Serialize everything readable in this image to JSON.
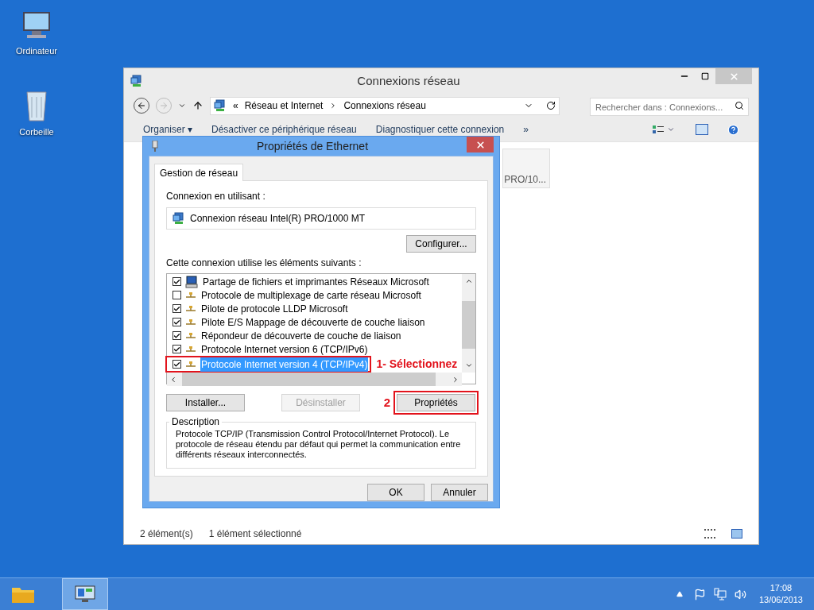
{
  "desktop_icons": [
    {
      "label": "Ordinateur",
      "kind": "computer"
    },
    {
      "label": "Corbeille",
      "kind": "bin"
    }
  ],
  "explorer": {
    "title": "Connexions réseau",
    "breadcrumb": [
      "«",
      "Réseau et Internet",
      "Connexions réseau"
    ],
    "search": {
      "placeholder": "Rechercher dans : Connexions..."
    },
    "toolbar": [
      "Organiser ▾",
      "Désactiver ce périphérique réseau",
      "Diagnostiquer cette connexion",
      "»"
    ],
    "tile_text": "PRO/10...",
    "status_bar": [
      "2 élément(s)",
      "1 élément sélectionné"
    ]
  },
  "dialog": {
    "title": "Propriétés de Ethernet",
    "tabs": [
      {
        "label": "Gestion de réseau",
        "selected": true
      }
    ],
    "connection_label": "Connexion en utilisant :",
    "adapter": "Connexion réseau Intel(R) PRO/1000 MT",
    "configure_button": "Configurer...",
    "components_label": "Cette connexion utilise les éléments suivants :",
    "components": [
      {
        "label": "Partage de fichiers et imprimantes Réseaux Microsoft",
        "checked": true,
        "selected": false,
        "kind": "service"
      },
      {
        "label": "Protocole de multiplexage de carte réseau Microsoft",
        "checked": false,
        "selected": false,
        "kind": "protocol"
      },
      {
        "label": "Pilote de protocole LLDP Microsoft",
        "checked": true,
        "selected": false,
        "kind": "protocol"
      },
      {
        "label": "Pilote E/S Mappage de découverte de couche liaison",
        "checked": true,
        "selected": false,
        "kind": "protocol"
      },
      {
        "label": "Répondeur de découverte de couche de liaison",
        "checked": true,
        "selected": false,
        "kind": "protocol"
      },
      {
        "label": "Protocole Internet version 6 (TCP/IPv6)",
        "checked": true,
        "selected": false,
        "kind": "protocol"
      },
      {
        "label": "Protocole Internet version 4 (TCP/IPv4)",
        "checked": true,
        "selected": true,
        "kind": "protocol"
      }
    ],
    "install_button": {
      "label": "Installer...",
      "disabled": false
    },
    "uninstall_button": {
      "label": "Désinstaller",
      "disabled": true
    },
    "properties_button": {
      "label": "Propriétés",
      "disabled": false
    },
    "description_label": "Description",
    "description": "Protocole TCP/IP (Transmission Control Protocol/Internet Protocol). Le protocole de réseau étendu par défaut qui permet la communication entre différents réseaux interconnectés.",
    "ok_button": "OK",
    "cancel_button": "Annuler"
  },
  "annotations": {
    "step_1": "1- Sélectionnez",
    "step_2": "2"
  },
  "taskbar": {
    "time": "17:08",
    "date": "13/06/2013"
  }
}
